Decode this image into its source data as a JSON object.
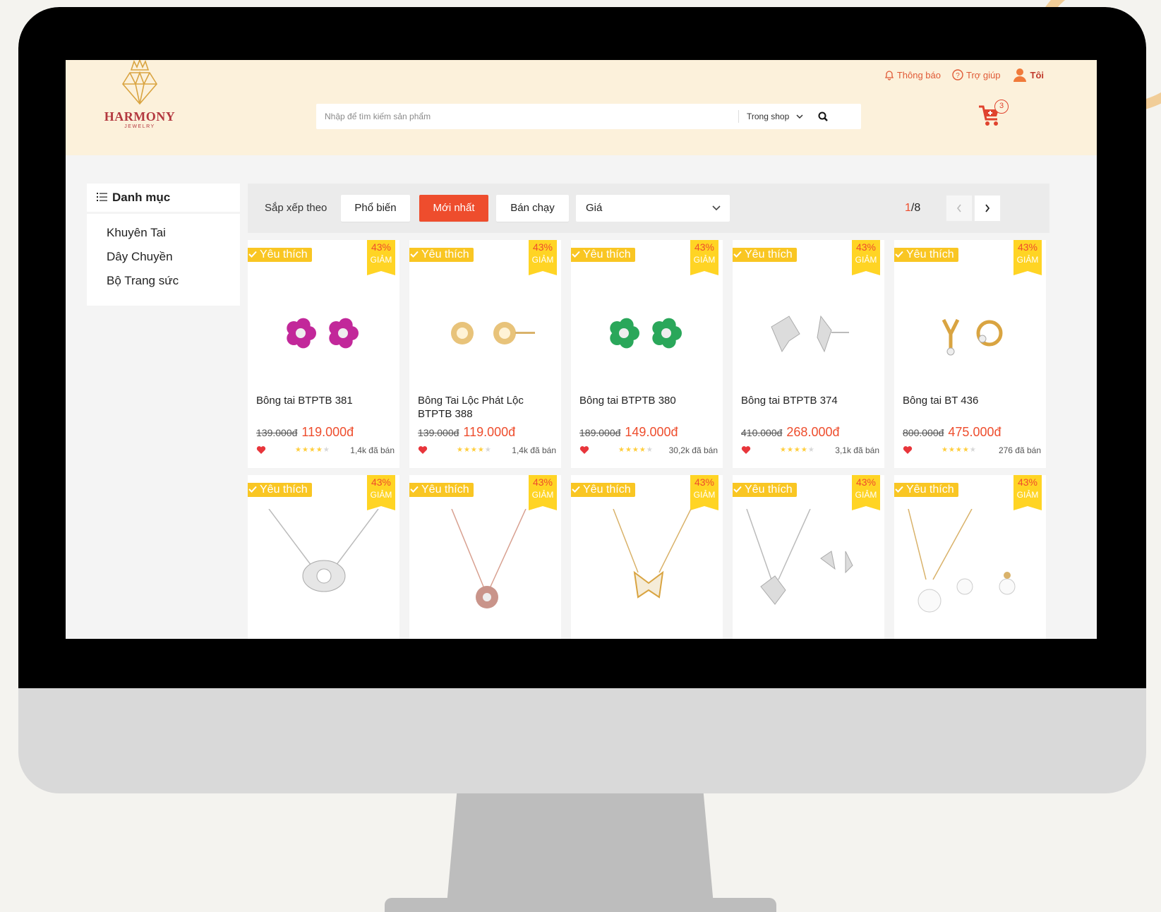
{
  "header": {
    "logo_name": "HARMONY",
    "logo_sub": "JEWELRY",
    "search_placeholder": "Nhập để tìm kiếm sản phẩm",
    "search_scope": "Trong shop",
    "links": {
      "notifications": "Thông báo",
      "help": "Trợ giúp",
      "me": "Tôi"
    },
    "cart_count": "3"
  },
  "sidebar": {
    "title": "Danh mục",
    "items": [
      "Khuyên Tai",
      "Dây Chuyền",
      "Bộ Trang sức"
    ]
  },
  "sortbar": {
    "label": "Sắp xếp theo",
    "options": [
      "Phổ biến",
      "Mới nhất",
      "Bán chạy"
    ],
    "active": "Mới nhất",
    "price_select": "Giá",
    "page_current": "1",
    "page_total": "/8"
  },
  "products": [
    {
      "fav": "Yêu thích",
      "discount": "43%",
      "discount_label": "GIẢM",
      "name": "Bông tai BTPTB 381",
      "old_price": "139.000đ",
      "price": "119.000đ",
      "rating": 4,
      "sold": "1,4k đã bán",
      "icon": "pink-flower-earrings"
    },
    {
      "fav": "Yêu thích",
      "discount": "43%",
      "discount_label": "GIẢM",
      "name": "Bông Tai Lộc Phát Lộc BTPTB 388",
      "old_price": "139.000đ",
      "price": "119.000đ",
      "rating": 4,
      "sold": "1,4k đã bán",
      "icon": "gold-coin-earrings"
    },
    {
      "fav": "Yêu thích",
      "discount": "43%",
      "discount_label": "GIẢM",
      "name": "Bông tai BTPTB 380",
      "old_price": "189.000đ",
      "price": "149.000đ",
      "rating": 4,
      "sold": "30,2k đã bán",
      "icon": "green-flower-earrings"
    },
    {
      "fav": "Yêu thích",
      "discount": "43%",
      "discount_label": "GIẢM",
      "name": "Bông tai BTPTB 374",
      "old_price": "410.000đ",
      "price": "268.000đ",
      "rating": 4,
      "sold": "3,1k đã bán",
      "icon": "silver-leaf-earrings"
    },
    {
      "fav": "Yêu thích",
      "discount": "43%",
      "discount_label": "GIẢM",
      "name": "Bông tai BT 436",
      "old_price": "800.000đ",
      "price": "475.000đ",
      "rating": 4,
      "sold": "276 đã bán",
      "icon": "gold-bow-earrings"
    },
    {
      "fav": "Yêu thích",
      "discount": "43%",
      "discount_label": "GIẢM",
      "icon": "silver-flower-necklace"
    },
    {
      "fav": "Yêu thích",
      "discount": "43%",
      "discount_label": "GIẢM",
      "icon": "rose-gold-pendant-necklace"
    },
    {
      "fav": "Yêu thích",
      "discount": "43%",
      "discount_label": "GIẢM",
      "icon": "gold-butterfly-necklace"
    },
    {
      "fav": "Yêu thích",
      "discount": "43%",
      "discount_label": "GIẢM",
      "icon": "silver-leaf-necklace-set"
    },
    {
      "fav": "Yêu thích",
      "discount": "43%",
      "discount_label": "GIẢM",
      "icon": "gold-pearl-necklace-set"
    }
  ],
  "colors": {
    "accent": "#ee4d2d",
    "header_bg": "#fcf1db",
    "badge": "#f9c623",
    "logo": "#b3383f"
  }
}
